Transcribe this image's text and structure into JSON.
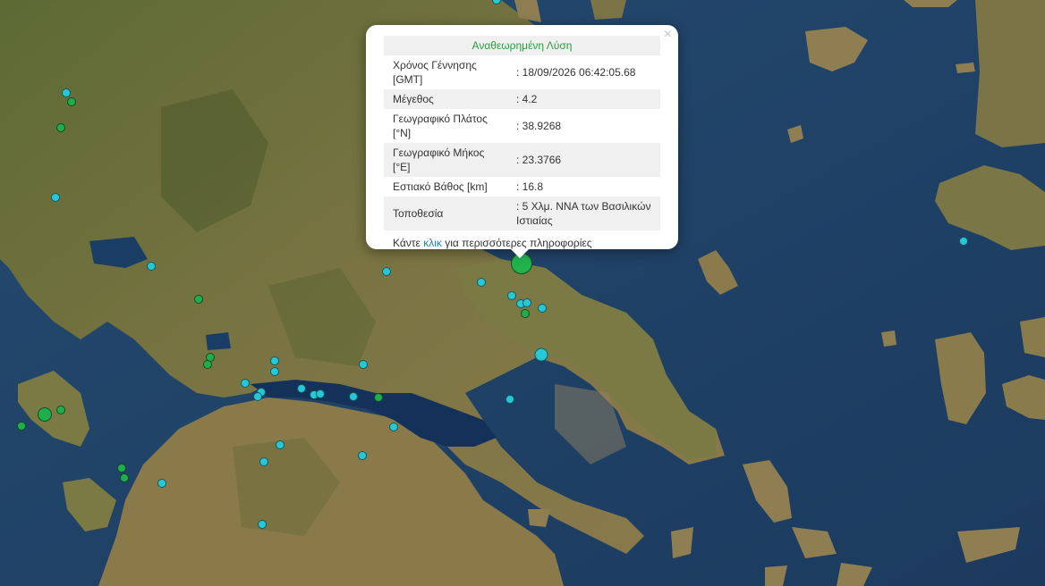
{
  "popup": {
    "title": "Αναθεωρημένη Λύση",
    "close": "×",
    "rows": [
      {
        "label": "Χρόνος Γέννησης [GMT]",
        "value": ": 18/09/2026 06:42:05.68"
      },
      {
        "label": "Μέγεθος",
        "value": ": 4.2"
      },
      {
        "label": "Γεωγραφικό Πλάτος [°N]",
        "value": ": 38.9268"
      },
      {
        "label": "Γεωγραφικό Μήκος [°E]",
        "value": ": 23.3766"
      },
      {
        "label": "Εστιακό Βάθος [km]",
        "value": ": 16.8"
      },
      {
        "label": "Τοποθεσία",
        "value": ": 5 Χλμ. ΝΝΑ των Βασιλικών Ιστιαίας"
      }
    ],
    "more_prefix": "Κάντε ",
    "more_link": "κλικ",
    "more_suffix": " για περισσότερες πληροφορίες"
  },
  "colors": {
    "sea": "#1f3f63",
    "land": "#6f7a3f",
    "recent_event": "#1fae4b",
    "older_event": "#27c8d6",
    "link": "#1a7fc1",
    "popup_title": "#2a9d3a"
  }
}
